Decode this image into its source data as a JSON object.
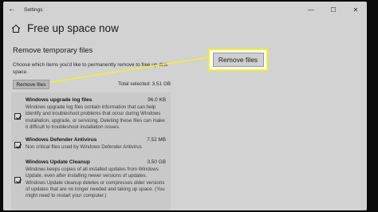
{
  "window": {
    "app_title": "Settings",
    "back_glyph": "←",
    "controls": {
      "minimize": "—",
      "maximize": "☐",
      "close": "✕"
    }
  },
  "page": {
    "title": "Free up space now",
    "home_icon": "home-icon"
  },
  "section": {
    "title": "Remove temporary files",
    "description": "Choose which items you'd like to permanently remove to free up disk space.",
    "remove_button_label": "Remove files",
    "total_selected": "Total selected: 3.51 GB"
  },
  "items": [
    {
      "name": "Windows upgrade log files",
      "size": "96.0 KB",
      "checked": true,
      "description": "Windows upgrade log files contain information that can help identify and troubleshoot problems that occur during Windows installation, upgrade, or servicing. Deleting these files can make it difficult to troubleshoot installation issues."
    },
    {
      "name": "Windows Defender Antivirus",
      "size": "7.52 MB",
      "checked": true,
      "description": "Non critical files used by Windows Defender Antivirus"
    },
    {
      "name": "Windows Update Cleanup",
      "size": "3.50 GB",
      "checked": true,
      "description": "Windows keeps copies of all installed updates from Windows Update, even after installing newer versions of updates. Windows Update cleanup deletes or compresses older versions of updates that are no longer needed and taking up space. (You might need to restart your computer.)"
    }
  ],
  "callout": {
    "label": "Remove files",
    "border_color": "#f6ef2a"
  }
}
